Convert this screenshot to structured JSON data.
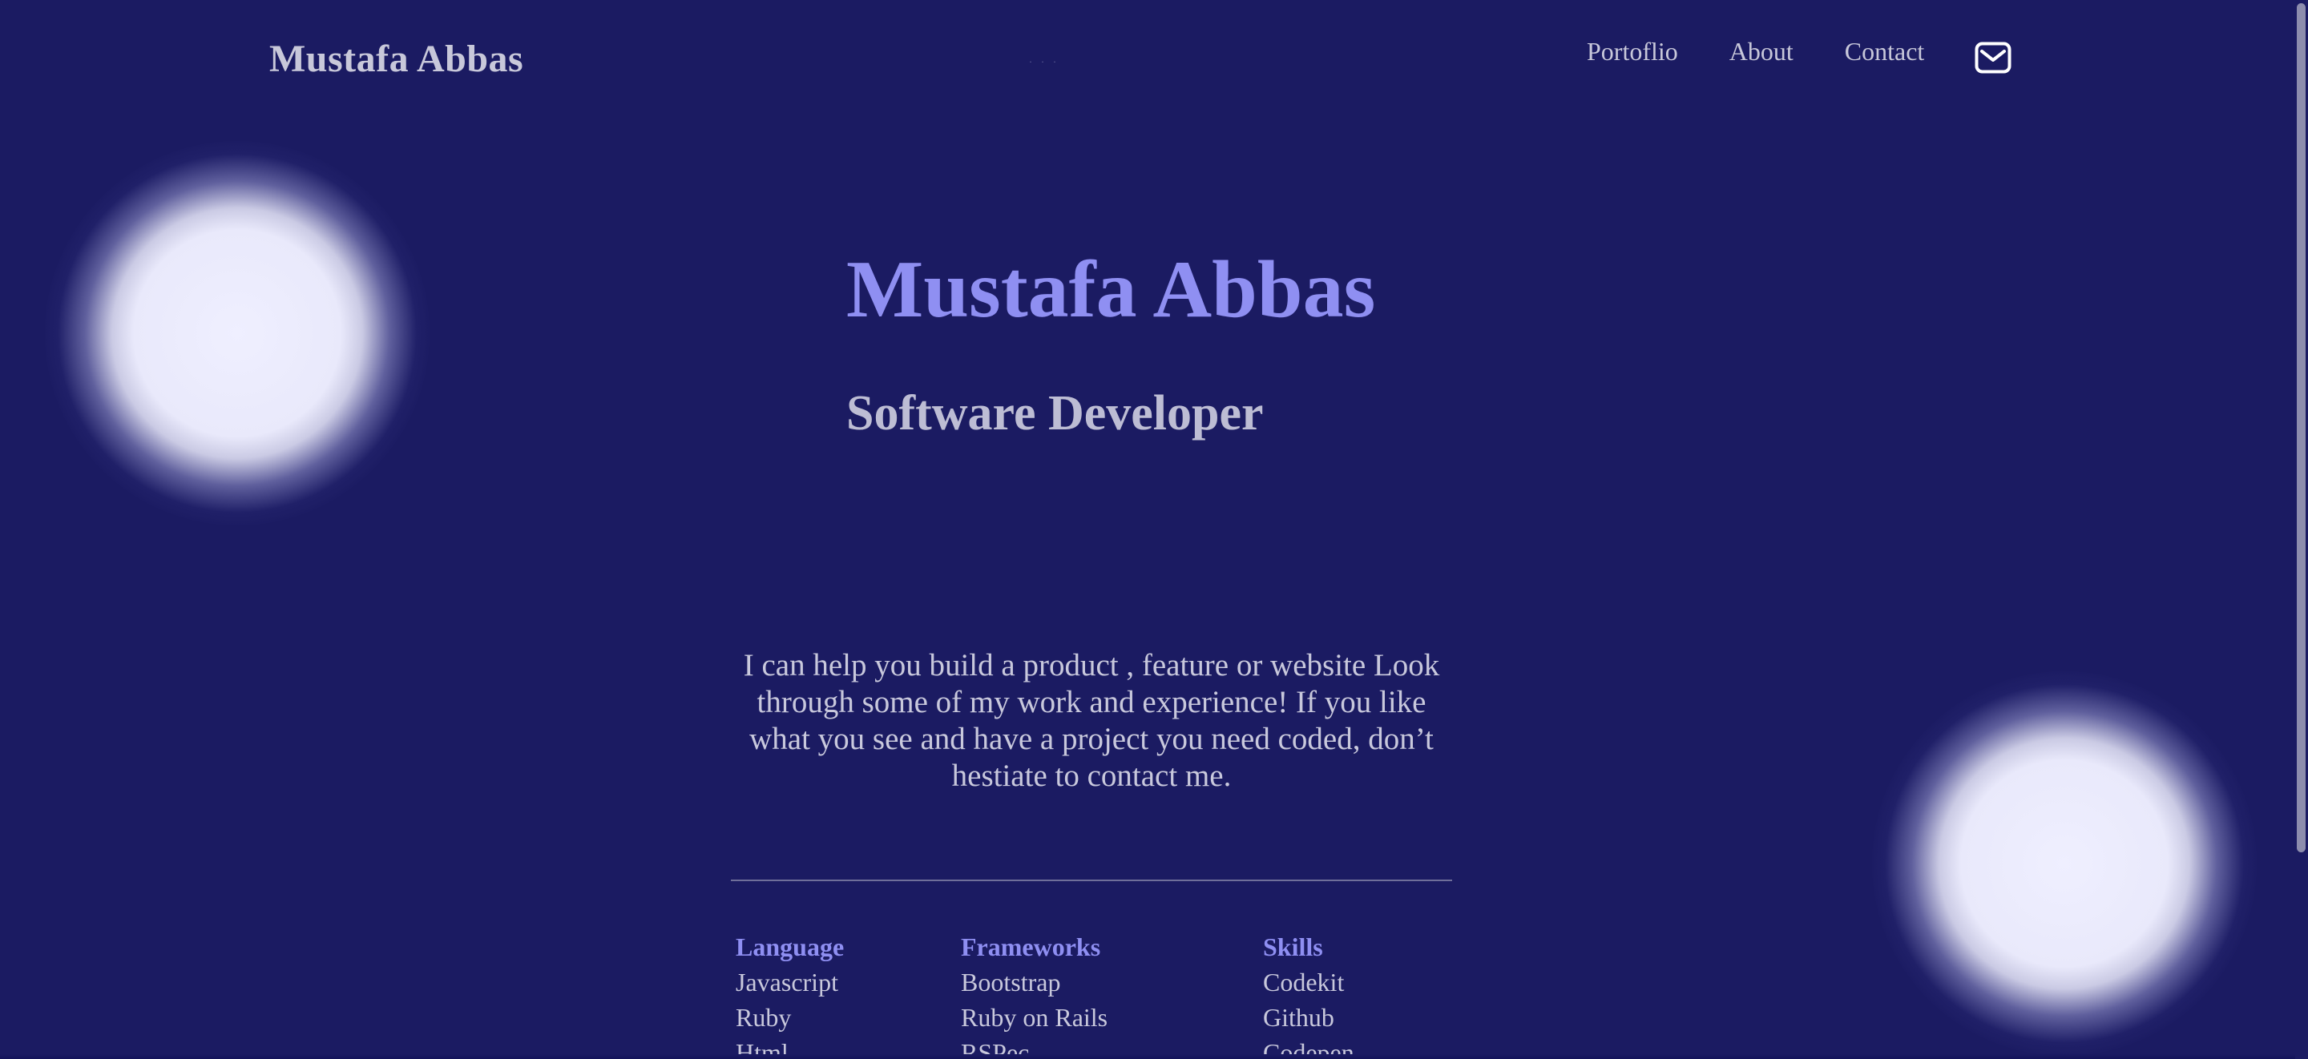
{
  "header": {
    "brand": "Mustafa Abbas",
    "dots": "· · ·",
    "nav": [
      "Portoflio",
      "About",
      "Contact"
    ],
    "mail_icon": "mail-icon"
  },
  "hero": {
    "name": "Mustafa Abbas",
    "role": "Software Developer",
    "intro": "I can help you build a product , feature or website Look through some of my work and experience! If you like what you see and have a project you need coded, don’t hestiate to contact me."
  },
  "skills": [
    {
      "title": "Language",
      "items": [
        "Javascript",
        "Ruby",
        "Html"
      ]
    },
    {
      "title": "Frameworks",
      "items": [
        "Bootstrap",
        "Ruby on Rails",
        "RSPec"
      ]
    },
    {
      "title": "Skills",
      "items": [
        "Codekit",
        "Github",
        "Codepen"
      ]
    }
  ],
  "colors": {
    "background": "#1b1b62",
    "accent": "#8f8ff2",
    "text": "#c8c8dc",
    "orb": "#efefff"
  }
}
